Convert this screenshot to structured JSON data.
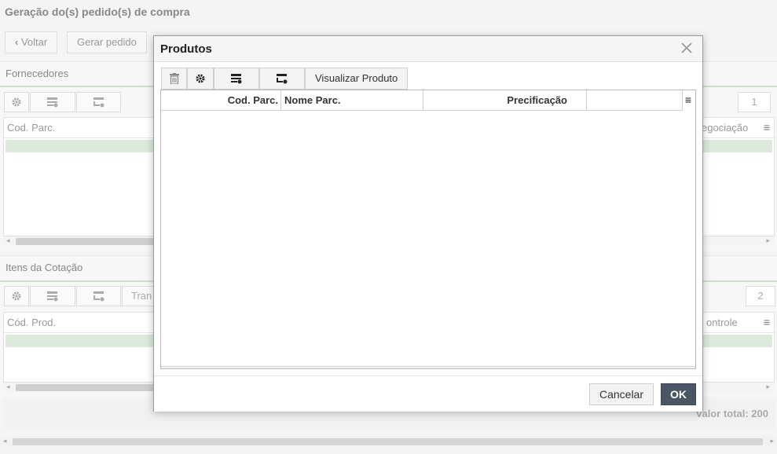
{
  "page": {
    "title": "Geração do(s) pedido(s) de compra",
    "back_label": "Voltar",
    "generate_label": "Gerar pedido"
  },
  "suppliers": {
    "title": "Fornecedores",
    "col_code": "Cod. Parc.",
    "col_negotiation_partial": "egociação",
    "page_number": "1"
  },
  "items": {
    "title": "Itens da Cotação",
    "toolbar_partial": "Tran",
    "col_code": "Cód. Prod.",
    "col_control_partial": "ontrole",
    "page_number": "2",
    "total": "Valor total: 200"
  },
  "modal": {
    "title": "Produtos",
    "view_product_label": "Visualizar Produto",
    "columns": [
      "Cod. Parc.",
      "Nome Parc.",
      "Precificação",
      ""
    ],
    "rows": [],
    "cancel_label": "Cancelar",
    "ok_label": "OK"
  },
  "colors": {
    "ok_button": "#4a5663",
    "selected_row": "#dce9dc"
  }
}
